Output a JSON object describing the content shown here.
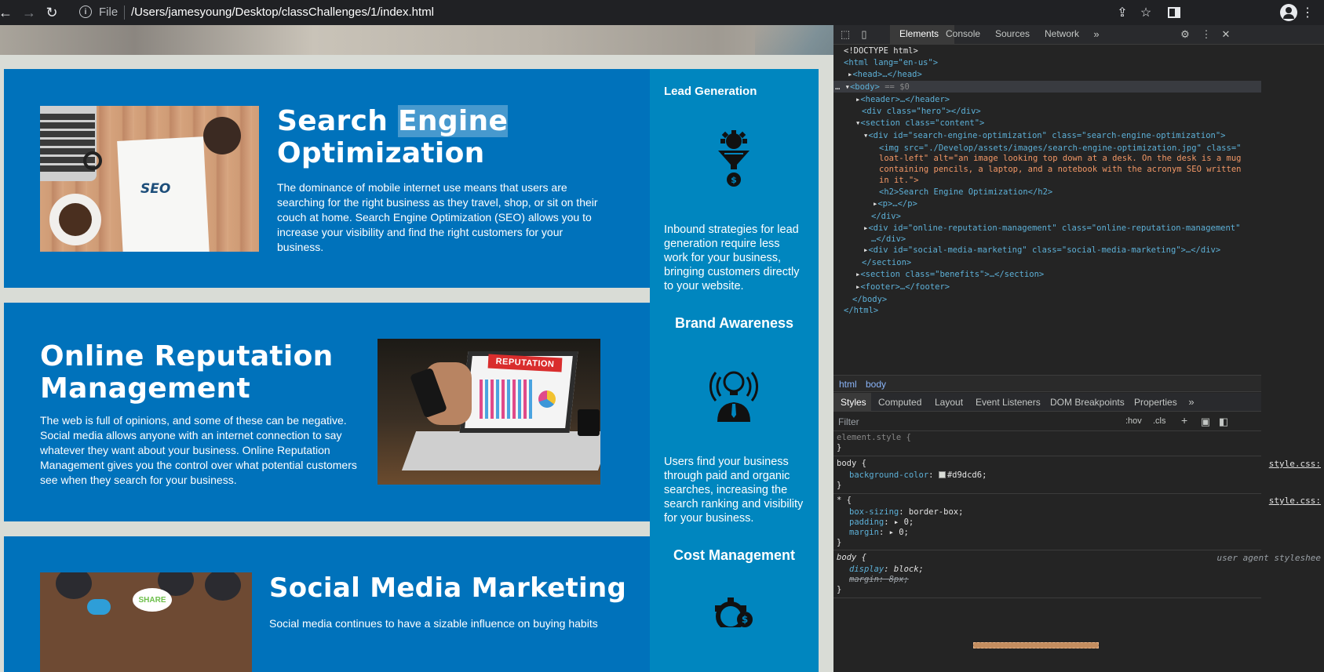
{
  "browser": {
    "file_label": "File",
    "url": "/Users/jamesyoung/Desktop/classChallenges/1/index.html"
  },
  "page": {
    "seo": {
      "title_part1": "Search ",
      "title_highlight": "Engine",
      "title_part2": "Optimization",
      "body": "The dominance of mobile internet use means that users are searching for the right business as they travel, shop, or sit on their couch at home. Search Engine Optimization (SEO) allows you to increase your visibility and find the right customers for your business.",
      "image": {
        "seo_word": "SEO"
      }
    },
    "orm": {
      "title_line1": "Online Reputation",
      "title_line2": "Management",
      "body": "The web is full of opinions, and some of these can be negative. Social media allows anyone with an internet connection to say whatever they want about your business. Online Reputation Management gives you the control over what potential customers see when they search for your business.",
      "image": {
        "banner": "REPUTATION"
      }
    },
    "smm": {
      "title": "Social Media Marketing",
      "body": "Social media continues to have a sizable influence on buying habits",
      "image": {
        "share": "SHARE"
      }
    },
    "aside": {
      "lead": {
        "title": "Lead Generation",
        "body": "Inbound strategies for lead generation require less work for your business, bringing customers directly to your website.",
        "icon": "funnel-gear-dollar-icon"
      },
      "brand": {
        "title": "Brand Awareness",
        "body": "Users find your business through paid and organic searches, increasing the search ranking and visibility for your business.",
        "icon": "lightbulb-person-icon"
      },
      "cost": {
        "title": "Cost Management",
        "icon": "gear-dollar-icon"
      }
    }
  },
  "devtools": {
    "tabs": [
      "Elements",
      "Console",
      "Sources",
      "Network"
    ],
    "dom": {
      "doctype": "<!DOCTYPE html>",
      "html_open": "<html lang=\"en-us\">",
      "head": "<head>…</head>",
      "body_open": "<body>",
      "body_eq": "== $0",
      "header": "<header>…</header>",
      "hero": "<div class=\"hero\"></div>",
      "section_content": "<section class=\"content\">",
      "div_seo": "<div id=\"search-engine-optimization\" class=\"search-engine-optimization\">",
      "img_line1": "<img src=\"./Develop/assets/images/search-engine-optimization.jpg\" class=\"",
      "img_line2": "loat-left\" alt=\"an image looking top down at a desk. On the desk is a mug",
      "img_line3": "containing pencils, a laptop, and a notebook with the acronym SEO written",
      "img_line4": "in it.\">",
      "h2": "<h2>Search Engine Optimization</h2>",
      "p": "<p>…</p>",
      "div_close": "</div>",
      "div_orm": "<div id=\"online-reputation-management\" class=\"online-reputation-management\"",
      "div_orm_close": "…</div>",
      "div_smm": "<div id=\"social-media-marketing\" class=\"social-media-marketing\">…</div>",
      "section_close": "</section>",
      "section_benefits": "<section class=\"benefits\">…</section>",
      "footer": "<footer>…</footer>",
      "body_close": "</body>",
      "html_close": "</html>"
    },
    "breadcrumb": [
      "html",
      "body"
    ],
    "style_tabs": [
      "Styles",
      "Computed",
      "Layout",
      "Event Listeners",
      "DOM Breakpoints",
      "Properties"
    ],
    "filter_placeholder": "Filter",
    "filter_tools": {
      "hov": ":hov",
      "cls": ".cls",
      "plus": "+"
    },
    "rules": {
      "element_style": "element.style {",
      "close": "}",
      "body_sel": "body {",
      "body_prop": "background-color",
      "body_val": "#d9dcd6;",
      "body_src": "style.css:",
      "star_sel": "* {",
      "star_src": "style.css:",
      "star_props": [
        {
          "prop": "box-sizing",
          "val": "border-box;"
        },
        {
          "prop": "padding",
          "val": "0;"
        },
        {
          "prop": "margin",
          "val": "0;"
        }
      ],
      "ua_sel": "body {",
      "ua_src": "user agent styleshee",
      "ua_display_prop": "display",
      "ua_display_val": "block;",
      "ua_margin": "margin: 8px;"
    },
    "colors": {
      "accent_swatch": "#d9dcd6"
    }
  }
}
